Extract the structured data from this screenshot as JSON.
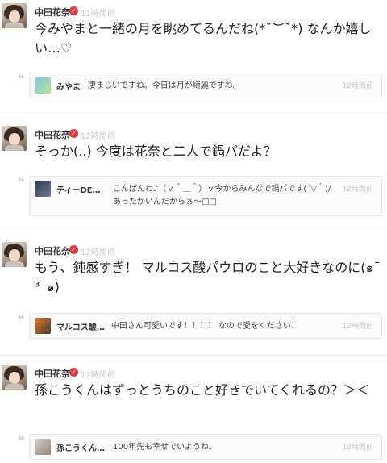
{
  "posts": [
    {
      "author": "中田花奈",
      "time": "11時間前",
      "text": "今みやまと一緒の月を眺めてるんだね(*˘︶˘*) なんか嬉しい…♡",
      "reply": {
        "author": "みやま",
        "text": "凄まじいですね。今日は月が綺麗ですね。",
        "time": "12時間前"
      }
    },
    {
      "author": "中田花奈",
      "time": "12時間前",
      "text": "そっか(..) 今度は花奈と二人で鍋パだよ？",
      "reply": {
        "author": "ティーDE…",
        "text": "こんばんわ♪（ｖ＾＿＾）ｖ今からみんなで鍋パです(´▽｀)/あったかいんだからぁ～□□",
        "time": "12時間前"
      }
    },
    {
      "author": "中田花奈",
      "time": "12時間前",
      "text": "もう、鈍感すぎ！ マルコス酸パウロのこと大好きなのに(๑¯ ³¯๑)",
      "reply": {
        "author": "マルコス酸…",
        "text": "中田さん可愛いです！！！！ なので愛をください！",
        "time": "12時間前"
      }
    },
    {
      "author": "中田花奈",
      "time": "12時間前",
      "text": "孫こうくんはずっとうちのこと好きでいてくれるの？＞＜",
      "reply": {
        "author": "孫こうくん…",
        "text": "100年先も幸せでいようね。",
        "time": "12時間前"
      }
    }
  ],
  "icons": {
    "verified": "verified-check-icon",
    "quote": "quote-icon"
  },
  "colors": {
    "badge": "#e23b3b",
    "time": "#c8c8c8"
  }
}
